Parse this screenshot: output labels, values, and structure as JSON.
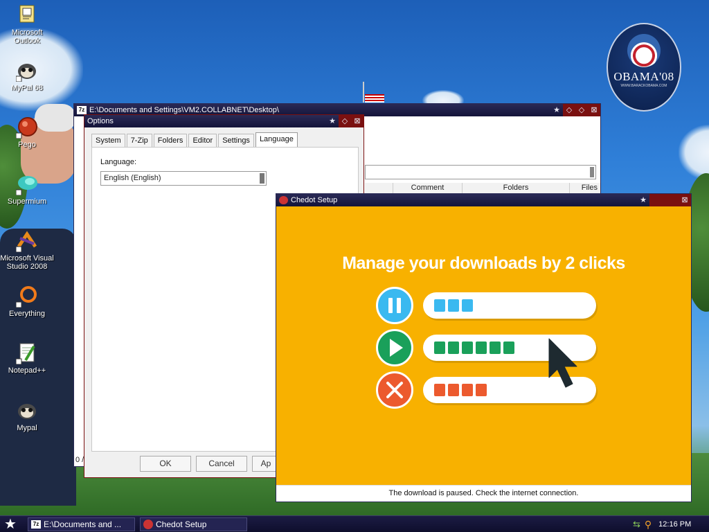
{
  "desktop": {
    "icons": [
      {
        "label": "Microsoft Outlook",
        "icon": "outlook-icon"
      },
      {
        "label": "MyPal 68",
        "icon": "mypal-icon"
      },
      {
        "label": "Pego",
        "icon": "pego-icon"
      },
      {
        "label": "Supermium",
        "icon": "supermium-icon"
      },
      {
        "label": "Microsoft Visual Studio 2008",
        "icon": "visual-studio-icon"
      },
      {
        "label": "Everything",
        "icon": "everything-icon"
      },
      {
        "label": "Notepad++",
        "icon": "notepadpp-icon"
      },
      {
        "label": "Mypal",
        "icon": "mypal-icon"
      }
    ],
    "badge": {
      "text": "OBAMA'08",
      "url": "WWW.BARACKOBAMA.COM"
    }
  },
  "explorer_window": {
    "title": "E:\\Documents and Settings\\VM2.COLLABNET\\Desktop\\",
    "columns": [
      "Comment",
      "Folders",
      "Files"
    ],
    "status_left": "0 /"
  },
  "options_dialog": {
    "title": "Options",
    "tabs": [
      "System",
      "7-Zip",
      "Folders",
      "Editor",
      "Settings",
      "Language"
    ],
    "active_tab": "Language",
    "language_label": "Language:",
    "language_value": "English (English)",
    "buttons": {
      "ok": "OK",
      "cancel": "Cancel",
      "apply": "Ap"
    }
  },
  "setup_window": {
    "title": "Chedot Setup",
    "headline": "Manage your downloads by 2 clicks",
    "rows": [
      {
        "control": "pause",
        "color": "#3ab9f0",
        "blocks": 3
      },
      {
        "control": "play",
        "color": "#1aa05a",
        "blocks": 6
      },
      {
        "control": "cancel",
        "color": "#ec5a2e",
        "blocks": 4
      }
    ],
    "status": "The download is paused. Check the internet connection."
  },
  "taskbar": {
    "tasks": [
      {
        "label": "E:\\Documents and ...",
        "icon": "7zip-icon"
      },
      {
        "label": "Chedot Setup",
        "icon": "chedot-icon"
      }
    ],
    "clock": "12:16 PM"
  }
}
